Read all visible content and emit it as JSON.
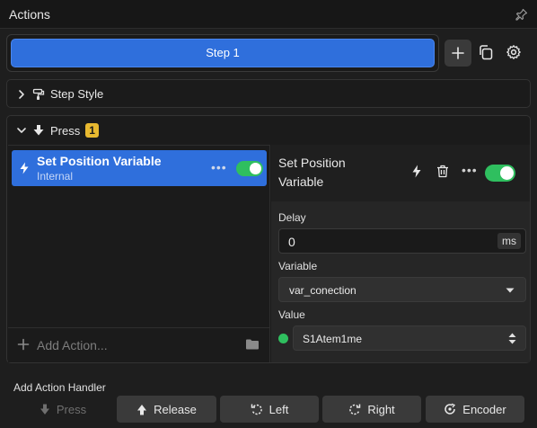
{
  "panel": {
    "title": "Actions",
    "pin_icon": "pin-icon"
  },
  "step": {
    "label": "Step 1",
    "add_icon": "plus-icon",
    "copy_icon": "copy-icon",
    "settings_icon": "gear-icon"
  },
  "step_style": {
    "label": "Step Style",
    "expanded": false
  },
  "press": {
    "label": "Press",
    "count": "1",
    "expanded": true,
    "actions": [
      {
        "name": "Set Position Variable",
        "category": "Internal",
        "enabled": true,
        "selected": true
      }
    ],
    "add_action_label": "Add Action..."
  },
  "details": {
    "title": "Set Position Variable",
    "enabled": true,
    "delay": {
      "label": "Delay",
      "value": "0",
      "unit": "ms"
    },
    "variable": {
      "label": "Variable",
      "value": "var_conection"
    },
    "value": {
      "label": "Value",
      "value": "S1Atem1me",
      "status_color": "#2fbf5f"
    }
  },
  "handlers": {
    "label": "Add Action Handler",
    "buttons": [
      {
        "label": "Press",
        "enabled": false
      },
      {
        "label": "Release",
        "enabled": true
      },
      {
        "label": "Left",
        "enabled": true
      },
      {
        "label": "Right",
        "enabled": true
      },
      {
        "label": "Encoder",
        "enabled": true
      }
    ]
  },
  "colors": {
    "accent": "#2f6fdc",
    "toggle_on": "#2fbf5f",
    "badge": "#e8b930"
  }
}
